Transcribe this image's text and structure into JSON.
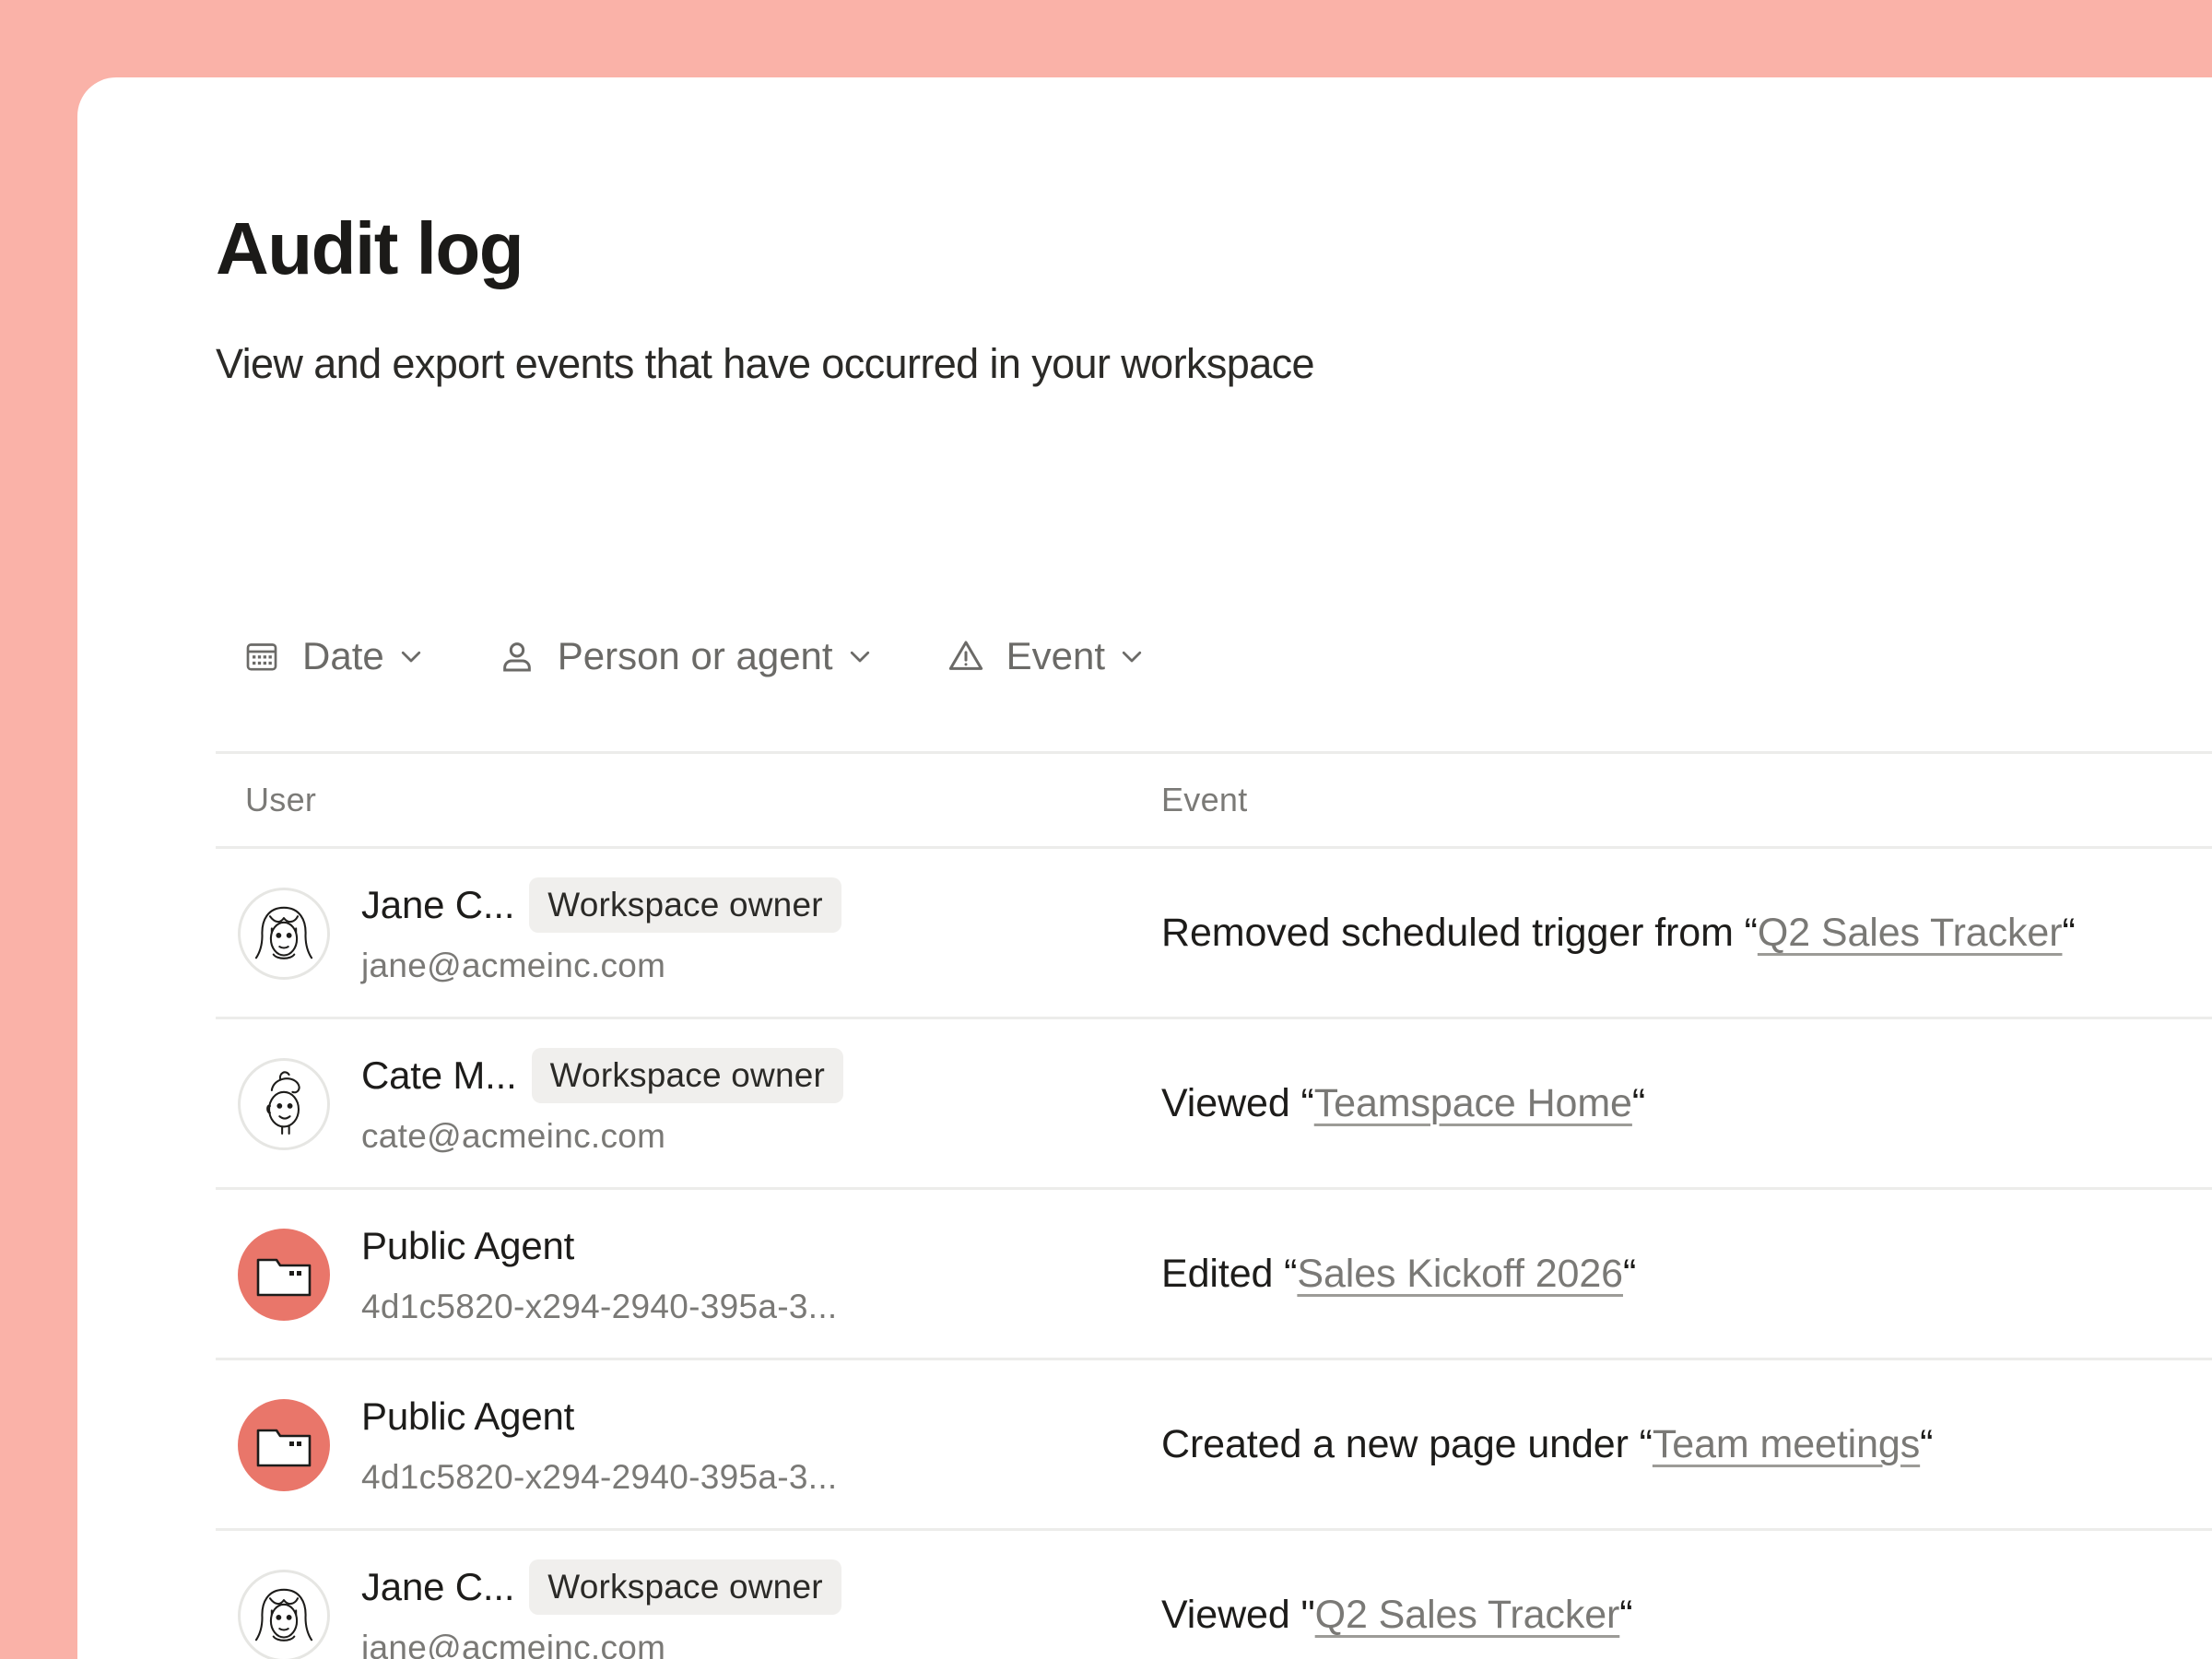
{
  "page": {
    "title": "Audit log",
    "subtitle": "View and export events that have occurred in your workspace"
  },
  "filters": [
    {
      "label": "Date",
      "icon": "calendar-icon"
    },
    {
      "label": "Person or agent",
      "icon": "person-icon"
    },
    {
      "label": "Event",
      "icon": "warning-icon"
    }
  ],
  "table": {
    "columns": {
      "user": "User",
      "event": "Event"
    },
    "rows": [
      {
        "avatar": "jane-avatar",
        "name": "Jane C...",
        "badge": "Workspace owner",
        "email": "jane@acmeinc.com",
        "event_prefix": "Removed scheduled trigger from “",
        "event_link": "Q2 Sales Tracker",
        "event_suffix": "“"
      },
      {
        "avatar": "cate-avatar",
        "name": "Cate M...",
        "badge": "Workspace owner",
        "email": "cate@acmeinc.com",
        "event_prefix": "Viewed “",
        "event_link": "Teamspace Home",
        "event_suffix": "“"
      },
      {
        "avatar": "agent-avatar",
        "name": "Public Agent",
        "badge": "",
        "email": "4d1c5820-x294-2940-395a-3...",
        "event_prefix": "Edited “",
        "event_link": "Sales Kickoff 2026",
        "event_suffix": "“"
      },
      {
        "avatar": "agent-avatar",
        "name": "Public Agent",
        "badge": "",
        "email": "4d1c5820-x294-2940-395a-3...",
        "event_prefix": "Created a new page under “",
        "event_link": "Team meetings",
        "event_suffix": "“"
      },
      {
        "avatar": "jane-avatar",
        "name": "Jane C...",
        "badge": "Workspace owner",
        "email": "jane@acmeinc.com",
        "event_prefix": "Viewed \"",
        "event_link": "Q2 Sales Tracker",
        "event_suffix": "“"
      }
    ]
  },
  "colors": {
    "background": "#fab2a8",
    "panel": "#ffffff",
    "agent_avatar": "#e9766a",
    "badge_bg": "#f0efed",
    "link": "#7a7976"
  }
}
